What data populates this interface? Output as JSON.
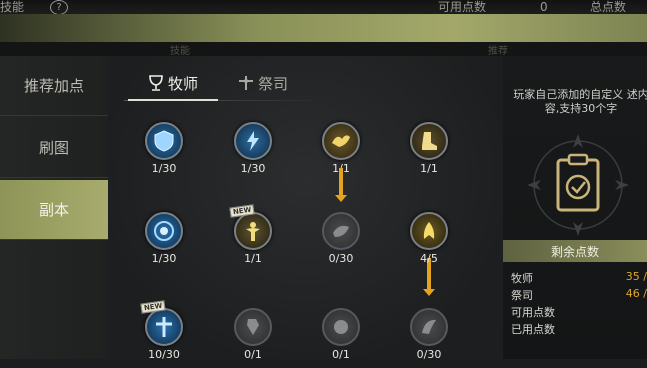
{
  "header": {
    "title": "技能",
    "available_points_label": "可用点数",
    "available_points_value": "0",
    "total_points_label": "总点数",
    "sub_left": "技能",
    "sub_right": "推荐"
  },
  "sidebar": {
    "items": [
      {
        "label": "推荐加点",
        "active": false
      },
      {
        "label": "刷图",
        "active": false
      },
      {
        "label": "副本",
        "active": true
      }
    ]
  },
  "tabs": [
    {
      "label": "牧师",
      "icon": "chalice-icon",
      "selected": true
    },
    {
      "label": "祭司",
      "icon": "cross-icon",
      "selected": false
    }
  ],
  "skills": [
    {
      "name": "shield-skill",
      "level": "1/30",
      "learned": true,
      "color": "#4aa7e6"
    },
    {
      "name": "lightning-skill",
      "level": "1/30",
      "learned": true,
      "color": "#5bb5f0"
    },
    {
      "name": "bird-skill",
      "level": "1/1",
      "learned": true,
      "color": "#e8c860"
    },
    {
      "name": "boots-skill",
      "level": "1/1",
      "learned": true,
      "color": "#e6cf7a"
    },
    {
      "name": "orb-skill",
      "level": "1/30",
      "learned": true,
      "color": "#3fa0e0"
    },
    {
      "name": "figure-skill",
      "level": "1/1",
      "learned": true,
      "color": "#e8d070",
      "new": "NEW"
    },
    {
      "name": "locked-skill-a",
      "level": "0/30",
      "learned": false,
      "color": "#777"
    },
    {
      "name": "wing-skill",
      "level": "4/5",
      "learned": true,
      "color": "#e0c050"
    },
    {
      "name": "cross-skill",
      "level": "10/30",
      "learned": true,
      "color": "#6ab8ee",
      "new": "NEW"
    },
    {
      "name": "locked-skill-b",
      "level": "0/1",
      "learned": false,
      "color": "#777"
    },
    {
      "name": "locked-skill-c",
      "level": "0/1",
      "learned": false,
      "color": "#777"
    },
    {
      "name": "locked-skill-d",
      "level": "0/30",
      "learned": false,
      "color": "#777"
    }
  ],
  "info_panel": {
    "description": "玩家自己添加的自定义 述内容,支持30个字",
    "remaining_title": "剩余点数",
    "rows": [
      {
        "label": "牧师",
        "value": "35 /"
      },
      {
        "label": "祭司",
        "value": "46 /"
      },
      {
        "label": "可用点数",
        "value": ""
      },
      {
        "label": "已用点数",
        "value": ""
      }
    ]
  },
  "colors": {
    "accent": "#a7ac6e",
    "arrow": "#e3a51f"
  }
}
